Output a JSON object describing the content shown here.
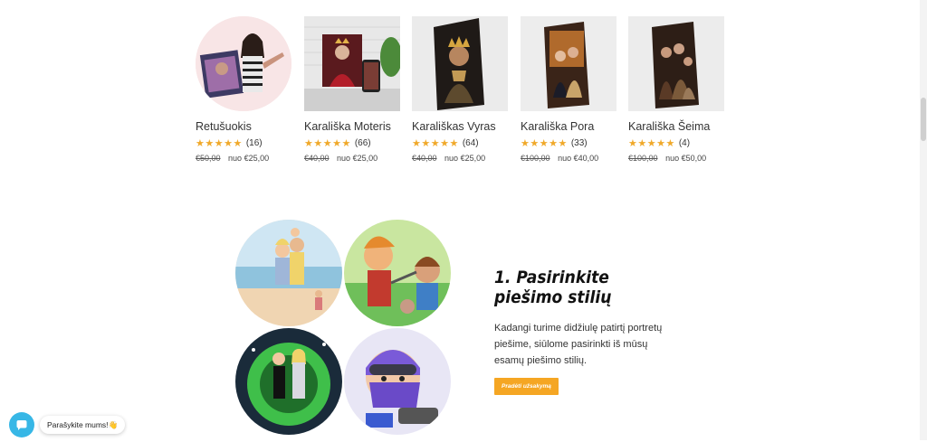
{
  "products": [
    {
      "name": "Retušuokis",
      "reviews": "(16)",
      "old_price": "€50,00",
      "price": "nuo €25,00",
      "rating": 5
    },
    {
      "name": "Karališka Moteris",
      "reviews": "(66)",
      "old_price": "€40,00",
      "price": "nuo €25,00",
      "rating": 5
    },
    {
      "name": "Karališkas Vyras",
      "reviews": "(64)",
      "old_price": "€40,00",
      "price": "nuo €25,00",
      "rating": 5
    },
    {
      "name": "Karališka Pora",
      "reviews": "(33)",
      "old_price": "€100,00",
      "price": "nuo €40,00",
      "rating": 5
    },
    {
      "name": "Karališka Šeima",
      "reviews": "(4)",
      "old_price": "€100,00",
      "price": "nuo €50,00",
      "rating": 5
    }
  ],
  "stars": "★★★★★",
  "step": {
    "title": "1. Pasirinkite piešimo stilių",
    "text": "Kadangi turime didžiulę patirtį portretų piešime, siūlome pasirinkti iš mūsų esamų piešimo stilių.",
    "cta": "Pradėti užsakymą"
  },
  "chat": {
    "label": "Parašykite mums!👋"
  },
  "colors": {
    "accent": "#f5a623",
    "star": "#f0a92a",
    "chat": "#37b7e6"
  }
}
